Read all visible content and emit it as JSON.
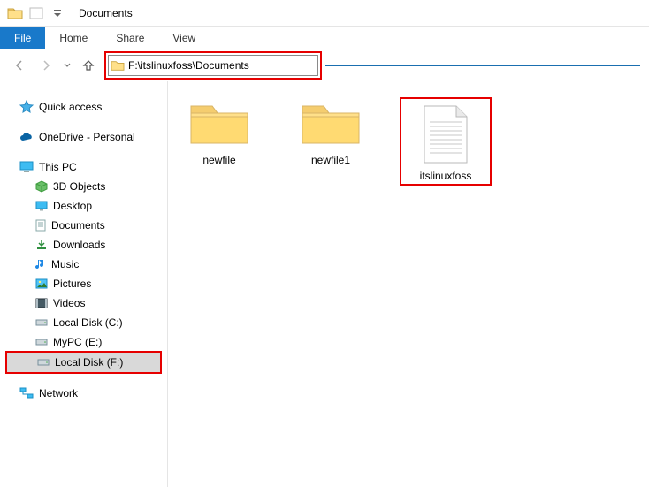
{
  "titlebar": {
    "title": "Documents"
  },
  "ribbon": {
    "file": "File",
    "tabs": [
      "Home",
      "Share",
      "View"
    ]
  },
  "nav": {
    "address": "F:\\itslinuxfoss\\Documents"
  },
  "sidebar": {
    "quick_access": "Quick access",
    "onedrive": "OneDrive - Personal",
    "this_pc": "This PC",
    "children": [
      "3D Objects",
      "Desktop",
      "Documents",
      "Downloads",
      "Music",
      "Pictures",
      "Videos",
      "Local Disk (C:)",
      "MyPC (E:)",
      "Local Disk (F:)"
    ],
    "network": "Network"
  },
  "files": {
    "items": [
      {
        "name": "newfile",
        "type": "folder"
      },
      {
        "name": "newfile1",
        "type": "folder"
      },
      {
        "name": "itslinuxfoss",
        "type": "text"
      }
    ]
  }
}
